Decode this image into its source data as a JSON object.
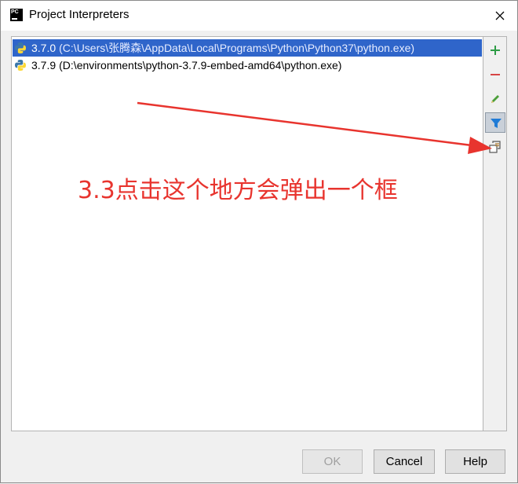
{
  "window": {
    "title": "Project Interpreters",
    "app_icon_text": "PC"
  },
  "interpreters": [
    {
      "version": "3.7.0",
      "path": "(C:\\Users\\张腾森\\AppData\\Local\\Programs\\Python\\Python37\\python.exe)",
      "selected": true
    },
    {
      "version": "3.7.9",
      "path": "(D:\\environments\\python-3.7.9-embed-amd64\\python.exe)",
      "selected": false
    }
  ],
  "toolbar": {
    "icons": [
      "add-icon",
      "remove-icon",
      "edit-icon",
      "filter-icon",
      "show-paths-icon"
    ],
    "colors": {
      "add": "#2e9c46",
      "remove": "#d64545",
      "edit": "#4c9f3a",
      "filter": "#1f7bd6",
      "active_bg": "#c9d0d9"
    }
  },
  "annotation": {
    "text": "3.3点击这个地方会弹出一个框",
    "color": "#e8342e"
  },
  "buttons": {
    "ok": "OK",
    "cancel": "Cancel",
    "help": "Help"
  },
  "colors": {
    "selection": "#2f65ca",
    "panel_bg": "#ffffff",
    "window_bg": "#f0f0f0"
  }
}
